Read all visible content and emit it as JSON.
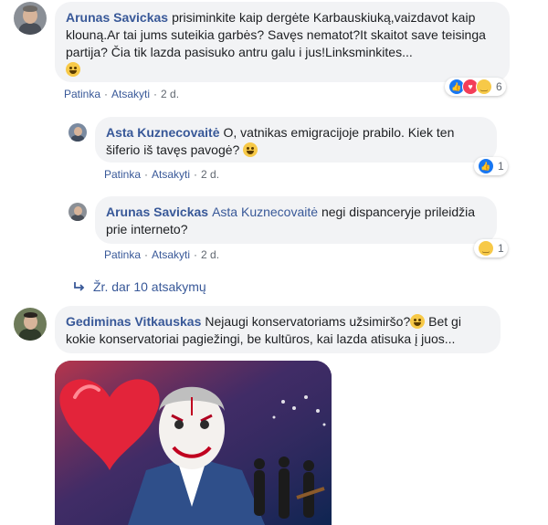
{
  "comments": [
    {
      "author": "Arunas Savickas",
      "text": "prisiminkite kaip dergėte Karbauskiuką,vaizdavot kaip klouną.Ar tai jums suteikia garbės? Savęs nematot?It skaitot save teisinga partija? Čia tik lazda pasisuko antru galu i jus!Linksminkites...",
      "emoji": "grinning-face-emoji",
      "actions": {
        "like": "Patinka",
        "reply": "Atsakyti",
        "time": "2 d."
      },
      "reactions": {
        "icons": [
          "like-icon",
          "love-icon",
          "haha-icon"
        ],
        "count": "6"
      }
    },
    {
      "author": "Asta Kuznecovaitė",
      "text": "O, vatnikas emigracijoje prabilo. Kiek ten šiferio iš tavęs pavogė?",
      "emoji": "grinning-face-emoji",
      "actions": {
        "like": "Patinka",
        "reply": "Atsakyti",
        "time": "2 d."
      },
      "reactions": {
        "icons": [
          "like-icon"
        ],
        "count": "1"
      }
    },
    {
      "author": "Arunas Savickas",
      "mention": "Asta Kuznecovaitė",
      "text": "negi dispanceryje prileidžia prie interneto?",
      "actions": {
        "like": "Patinka",
        "reply": "Atsakyti",
        "time": "2 d."
      },
      "reactions": {
        "icons": [
          "haha-icon"
        ],
        "count": "1"
      }
    },
    {
      "author": "Gediminas Vitkauskas",
      "text_before_emoji": "Nejaugi konservatoriams užsimiršo?",
      "text_after_emoji": " Bet gi kokie konservatoriai pagiežingi, be kultūros, kai lazda atisuka į juos...",
      "emoji": "grinning-face-emoji"
    }
  ],
  "more_replies": {
    "label": "Žr. dar 10 atsakymų",
    "icon": "reply-arrow-icon"
  },
  "colors": {
    "link": "#385898",
    "bubble": "#f2f3f5",
    "meta": "#606770",
    "like": "#1877f2",
    "love": "#f33e58",
    "haha": "#f7c948"
  }
}
